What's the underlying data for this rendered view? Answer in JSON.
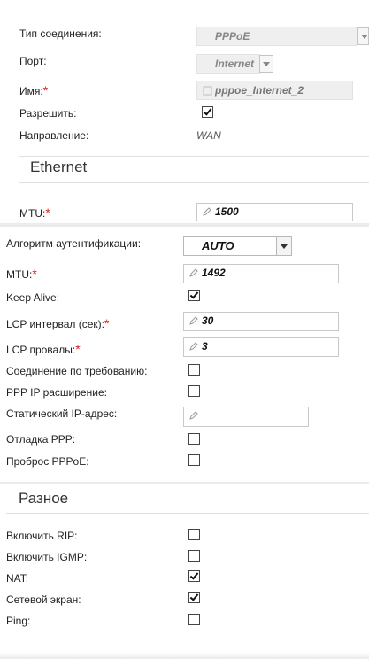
{
  "connection": {
    "type_label": "Тип соединения:",
    "type_value": "PPPoE",
    "port_label": "Порт:",
    "port_value": "Internet",
    "name_label": "Имя:",
    "name_value": "pppoe_Internet_2",
    "enable_label": "Разрешить:",
    "enable_checked": true,
    "direction_label": "Направление:",
    "direction_value": "WAN",
    "required_mark": "*"
  },
  "ethernet": {
    "title": "Ethernet",
    "mtu_label": "MTU:",
    "mtu_value": "1500"
  },
  "ppp": {
    "auth_label": "Алгоритм аутентификации:",
    "auth_value": "AUTO",
    "mtu_label": "MTU:",
    "mtu_value": "1492",
    "keepalive_label": "Keep Alive:",
    "keepalive_checked": true,
    "lcp_interval_label": "LCP интервал (сек):",
    "lcp_interval_value": "30",
    "lcp_fails_label": "LCP провалы:",
    "lcp_fails_value": "3",
    "on_demand_label": "Соединение по требованию:",
    "on_demand_checked": false,
    "ppp_ip_ext_label": "PPP IP расширение:",
    "ppp_ip_ext_checked": false,
    "static_ip_label": "Статический IP-адрес:",
    "static_ip_value": "",
    "ppp_debug_label": "Отладка PPP:",
    "ppp_debug_checked": false,
    "pppoe_passthrough_label": "Проброс PPPoE:",
    "pppoe_passthrough_checked": false
  },
  "misc": {
    "title": "Разное",
    "rip_label": "Включить RIP:",
    "rip_checked": false,
    "igmp_label": "Включить IGMP:",
    "igmp_checked": false,
    "nat_label": "NAT:",
    "nat_checked": true,
    "firewall_label": "Сетевой экран:",
    "firewall_checked": true,
    "ping_label": "Ping:",
    "ping_checked": false
  }
}
